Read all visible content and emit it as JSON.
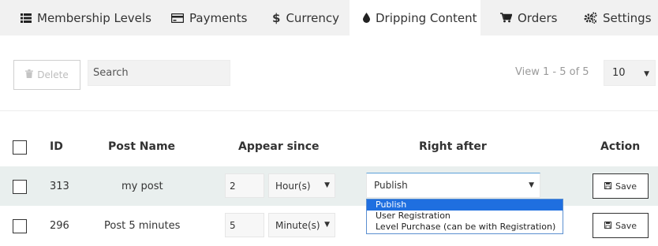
{
  "tabs": [
    {
      "label": "Membership Levels",
      "icon": "list-icon"
    },
    {
      "label": "Payments",
      "icon": "credit-card-icon"
    },
    {
      "label": "Currency",
      "icon": "dollar-icon"
    },
    {
      "label": "Dripping Content",
      "icon": "drop-icon",
      "active": true
    },
    {
      "label": "Orders",
      "icon": "cart-icon"
    },
    {
      "label": "Settings",
      "icon": "gears-icon"
    }
  ],
  "toolbar": {
    "delete_label": "Delete",
    "search_placeholder": "Search",
    "view_info": "View 1 - 5 of 5",
    "per_page": "10"
  },
  "table": {
    "headers": {
      "id": "ID",
      "post_name": "Post Name",
      "appear_since": "Appear since",
      "right_after": "Right after",
      "action": "Action"
    },
    "rows": [
      {
        "id": "313",
        "post_name": "my post",
        "amount": "2",
        "unit": "Hour(s)",
        "right_after": "Publish",
        "save": "Save"
      },
      {
        "id": "296",
        "post_name": "Post 5 minutes",
        "amount": "5",
        "unit": "Minute(s)",
        "save": "Save"
      }
    ]
  },
  "dropdown": {
    "options": [
      "Publish",
      "User Registration",
      "Level Purchase (can be with Registration)"
    ],
    "selected": "Publish"
  },
  "colors": {
    "tabbar_bg": "#f1f1f1",
    "row_highlight": "#e9efee",
    "dropdown_selected": "#1f6fe0"
  }
}
